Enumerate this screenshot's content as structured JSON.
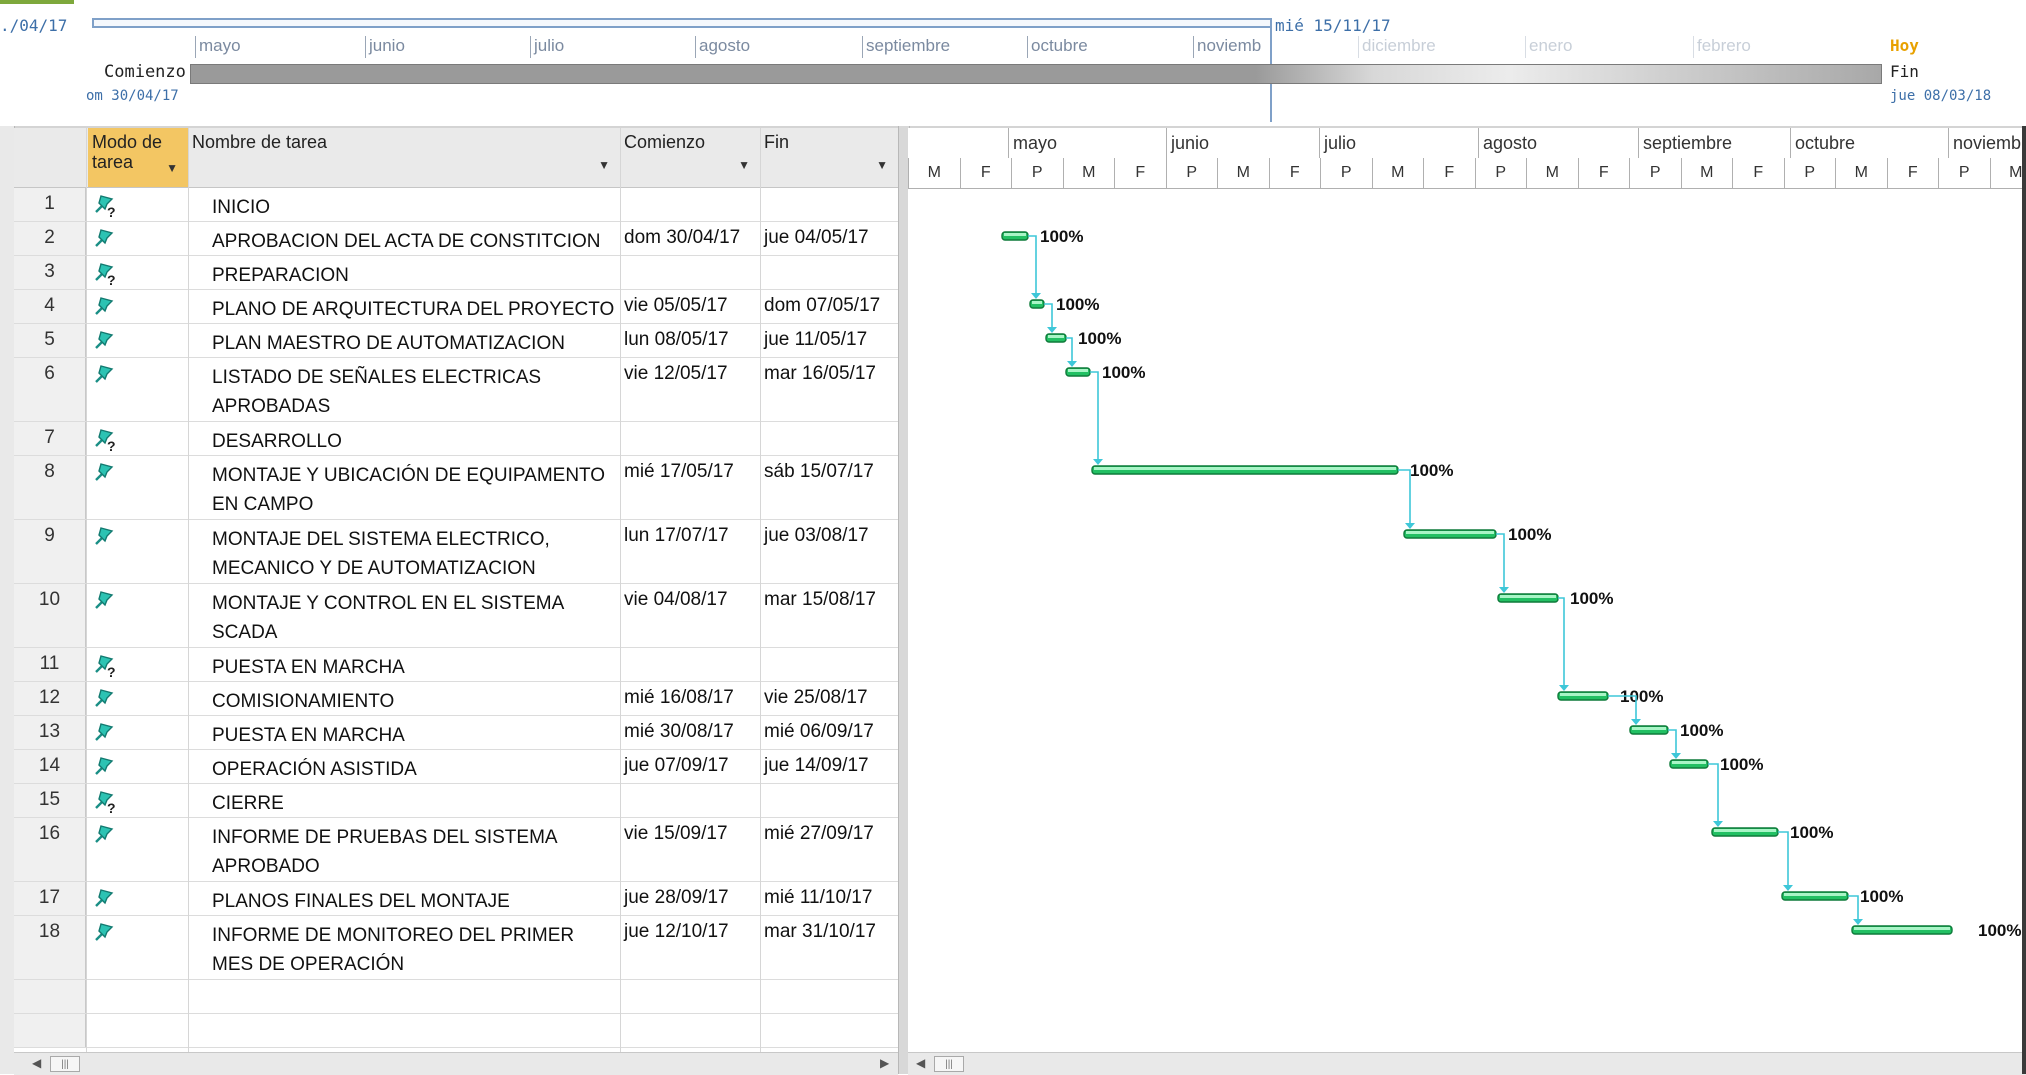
{
  "timeline": {
    "left_date": "./04/17",
    "months": [
      "mayo",
      "junio",
      "julio",
      "agosto",
      "septiembre",
      "octubre",
      "noviemb",
      "diciembre",
      "enero",
      "febrero"
    ],
    "cursor_label": "mié 15/11/17",
    "start_label": "Comienzo",
    "start_date": "om 30/04/17",
    "today_label": "Hoy",
    "end_label": "Fin",
    "end_date": "jue 08/03/18"
  },
  "table": {
    "headers": {
      "mode": "Modo de tarea",
      "name": "Nombre de tarea",
      "start": "Comienzo",
      "finish": "Fin"
    },
    "rows": [
      {
        "id": "1",
        "name": "INICIO",
        "start": "",
        "finish": "",
        "manual_q": true
      },
      {
        "id": "2",
        "name": "APROBACION DEL ACTA DE CONSTITCION",
        "start": "dom 30/04/17",
        "finish": "jue 04/05/17",
        "manual_q": false
      },
      {
        "id": "3",
        "name": "PREPARACION",
        "start": "",
        "finish": "",
        "manual_q": true
      },
      {
        "id": "4",
        "name": "PLANO DE ARQUITECTURA DEL PROYECTO",
        "start": "vie 05/05/17",
        "finish": "dom 07/05/17",
        "manual_q": false
      },
      {
        "id": "5",
        "name": "PLAN MAESTRO DE AUTOMATIZACION",
        "start": "lun 08/05/17",
        "finish": "jue 11/05/17",
        "manual_q": false
      },
      {
        "id": "6",
        "name": "LISTADO DE SEÑALES ELECTRICAS APROBADAS",
        "start": "vie 12/05/17",
        "finish": "mar 16/05/17",
        "manual_q": false
      },
      {
        "id": "7",
        "name": "DESARROLLO",
        "start": "",
        "finish": "",
        "manual_q": true
      },
      {
        "id": "8",
        "name": "MONTAJE Y UBICACIÓN DE EQUIPAMENTO EN CAMPO",
        "start": "mié 17/05/17",
        "finish": "sáb 15/07/17",
        "manual_q": false
      },
      {
        "id": "9",
        "name": "MONTAJE DEL SISTEMA ELECTRICO, MECANICO Y DE AUTOMATIZACION",
        "start": "lun 17/07/17",
        "finish": "jue 03/08/17",
        "manual_q": false
      },
      {
        "id": "10",
        "name": "MONTAJE Y CONTROL EN EL SISTEMA SCADA",
        "start": "vie 04/08/17",
        "finish": "mar 15/08/17",
        "manual_q": false
      },
      {
        "id": "11",
        "name": "PUESTA EN MARCHA",
        "start": "",
        "finish": "",
        "manual_q": true
      },
      {
        "id": "12",
        "name": "COMISIONAMIENTO",
        "start": "mié 16/08/17",
        "finish": "vie 25/08/17",
        "manual_q": false
      },
      {
        "id": "13",
        "name": "PUESTA EN MARCHA",
        "start": "mié 30/08/17",
        "finish": "mié 06/09/17",
        "manual_q": false
      },
      {
        "id": "14",
        "name": "OPERACIÓN ASISTIDA",
        "start": "jue 07/09/17",
        "finish": "jue 14/09/17",
        "manual_q": false
      },
      {
        "id": "15",
        "name": "CIERRE",
        "start": "",
        "finish": "",
        "manual_q": true
      },
      {
        "id": "16",
        "name": "INFORME DE PRUEBAS DEL SISTEMA APROBADO",
        "start": "vie 15/09/17",
        "finish": "mié 27/09/17",
        "manual_q": false
      },
      {
        "id": "17",
        "name": "PLANOS FINALES DEL MONTAJE",
        "start": "jue 28/09/17",
        "finish": "mié 11/10/17",
        "manual_q": false
      },
      {
        "id": "18",
        "name": "INFORME DE MONITOREO DEL PRIMER MES DE OPERACIÓN",
        "start": "jue 12/10/17",
        "finish": "mar 31/10/17",
        "manual_q": false
      }
    ]
  },
  "gantt": {
    "months": [
      "mayo",
      "junio",
      "julio",
      "agosto",
      "septiembre",
      "octubre",
      "noviemb"
    ],
    "day_letters": [
      "M",
      "F",
      "P",
      "M",
      "F",
      "P",
      "M",
      "F",
      "P",
      "M",
      "F",
      "P",
      "M",
      "F",
      "P",
      "M",
      "F",
      "P",
      "M",
      "F",
      "P",
      "M"
    ],
    "bars": [
      {
        "row": "2",
        "pct": "100%"
      },
      {
        "row": "4",
        "pct": "100%"
      },
      {
        "row": "5",
        "pct": "100%"
      },
      {
        "row": "6",
        "pct": "100%"
      },
      {
        "row": "8",
        "pct": "100%"
      },
      {
        "row": "9",
        "pct": "100%"
      },
      {
        "row": "10",
        "pct": "100%"
      },
      {
        "row": "12",
        "pct": "100%"
      },
      {
        "row": "13",
        "pct": "100%"
      },
      {
        "row": "14",
        "pct": "100%"
      },
      {
        "row": "16",
        "pct": "100%"
      },
      {
        "row": "17",
        "pct": "100%"
      },
      {
        "row": "18",
        "pct": "100%"
      }
    ]
  },
  "colors": {
    "bar_fill": "#22c063",
    "link": "#3ec7d8",
    "mode_header": "#f3c663"
  },
  "icons": {
    "manual_task": "pushpin-question-icon",
    "auto_task": "pushpin-icon"
  }
}
